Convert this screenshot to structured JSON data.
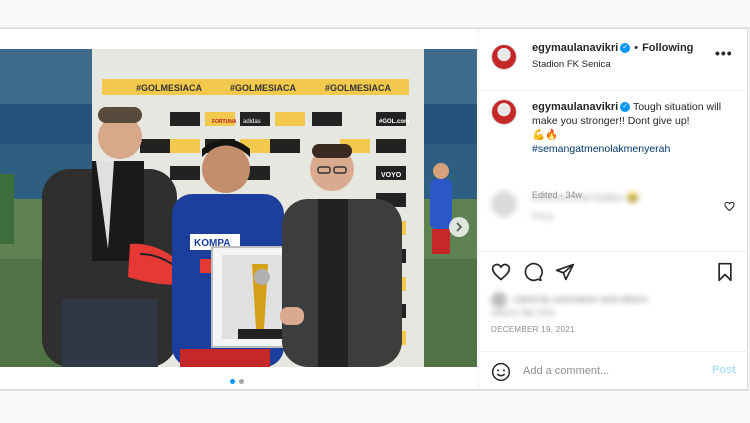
{
  "post": {
    "username": "egymaulanavikri",
    "following_label": "Following",
    "separator": "•",
    "location": "Stadion FK Senica",
    "more_label": "•••",
    "caption_username": "egymaulanavikri",
    "caption_text": "Tough situation will make you stronger!! Dont give up!",
    "caption_emojis": "💪🔥",
    "hashtag": "#semangatmenolakmenyerah",
    "edited_label": "Edited · 34w",
    "date": "DECEMBER 19, 2021",
    "verified_glyph": "✓"
  },
  "comment": {
    "text": "comment text hidden 😂",
    "reply_label": "Reply"
  },
  "likes": {
    "line1": "Liked by username and others",
    "line2": "others like this"
  },
  "comment_box": {
    "placeholder": "Add a comment...",
    "post_label": "Post"
  },
  "media": {
    "banner_text": "#GOLMESIACA",
    "sponsor_labels": [
      "FORTUNA",
      "adidas",
      "VOYO",
      "#GOL.com"
    ],
    "jersey_text": "KOMPA"
  },
  "colors": {
    "accent": "#0095f6",
    "text": "#262626",
    "muted": "#8e8e8e",
    "hashtag": "#00376b"
  },
  "icons": {
    "heart": "heart-icon",
    "comment": "comment-icon",
    "share": "share-icon",
    "bookmark": "bookmark-icon",
    "emoji": "emoji-icon",
    "next": "chevron-right-icon"
  }
}
